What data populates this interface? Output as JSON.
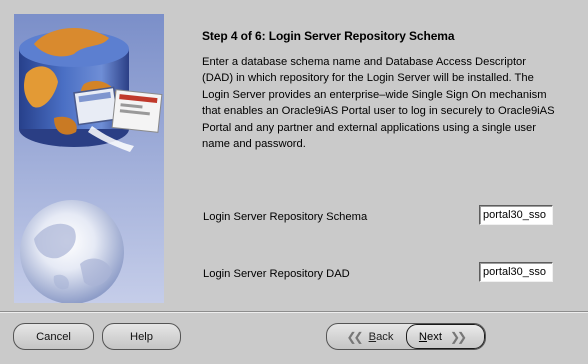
{
  "wizard": {
    "step_title": "Step 4 of 6: Login Server Repository Schema",
    "description": "Enter a database schema name and Database Access Descriptor (DAD) in which repository for the Login Server will be installed. The Login Server provides an enterprise–wide Single Sign On mechanism that enables an Oracle9iAS Portal user to log in securely to Oracle9iAS Portal and any partner and external applications using a single user name and password."
  },
  "fields": {
    "schema": {
      "label": "Login Server Repository Schema",
      "value": "portal30_sso"
    },
    "dad": {
      "label": "Login Server Repository DAD",
      "value": "portal30_sso"
    }
  },
  "buttons": {
    "cancel": "Cancel",
    "help": "Help",
    "back_mnemonic": "B",
    "back_rest": "ack",
    "next_mnemonic": "N",
    "next_rest": "ext"
  },
  "icons": {
    "side_art": "database-globe-illustration",
    "back": "double-chevron-left-icon",
    "next": "double-chevron-right-icon"
  }
}
